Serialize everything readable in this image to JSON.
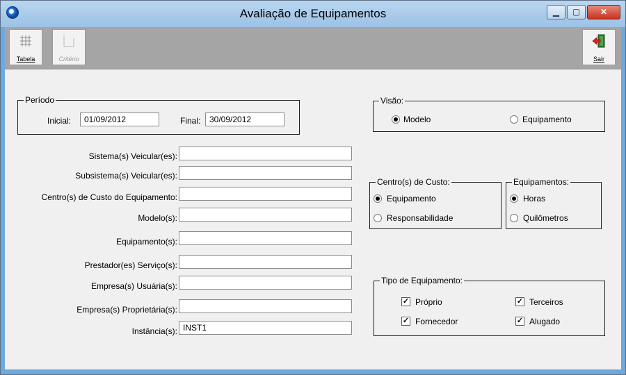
{
  "window": {
    "title": "Avaliação de Equipamentos"
  },
  "toolbar": {
    "tabela_label": "Tabela",
    "criterio_label": "Critério",
    "sair_label": "Sair"
  },
  "periodo": {
    "legend": "Período",
    "inicial_label": "Inicial:",
    "inicial_value": "01/09/2012",
    "final_label": "Final:",
    "final_value": "30/09/2012"
  },
  "filters": [
    {
      "label": "Sistema(s) Veicular(es):",
      "value": ""
    },
    {
      "label": "Subsistema(s) Veicular(es):",
      "value": ""
    },
    {
      "label": "Centro(s) de Custo do Equipamento:",
      "value": ""
    },
    {
      "label": "Modelo(s):",
      "value": ""
    },
    {
      "label": "Equipamento(s):",
      "value": ""
    },
    {
      "label": "Prestador(es) Serviço(s):",
      "value": ""
    },
    {
      "label": "Empresa(s) Usuária(s):",
      "value": ""
    },
    {
      "label": "Empresa(s) Proprietária(s):",
      "value": ""
    },
    {
      "label": "Instância(s):",
      "value": "INST1"
    }
  ],
  "visao": {
    "legend": "Visão:",
    "options": [
      {
        "label": "Modelo",
        "checked": true
      },
      {
        "label": "Equipamento",
        "checked": false
      }
    ]
  },
  "centro_custo": {
    "legend": "Centro(s) de Custo:",
    "options": [
      {
        "label": "Equipamento",
        "checked": true
      },
      {
        "label": "Responsabilidade",
        "checked": false
      }
    ]
  },
  "equipamentos": {
    "legend": "Equipamentos:",
    "options": [
      {
        "label": "Horas",
        "checked": true
      },
      {
        "label": "Quilômetros",
        "checked": false
      }
    ]
  },
  "tipo_equipamento": {
    "legend": "Tipo de Equipamento:",
    "options": [
      {
        "label": "Próprio",
        "checked": true
      },
      {
        "label": "Terceiros",
        "checked": true
      },
      {
        "label": "Fornecedor",
        "checked": true
      },
      {
        "label": "Alugado",
        "checked": true
      }
    ]
  }
}
